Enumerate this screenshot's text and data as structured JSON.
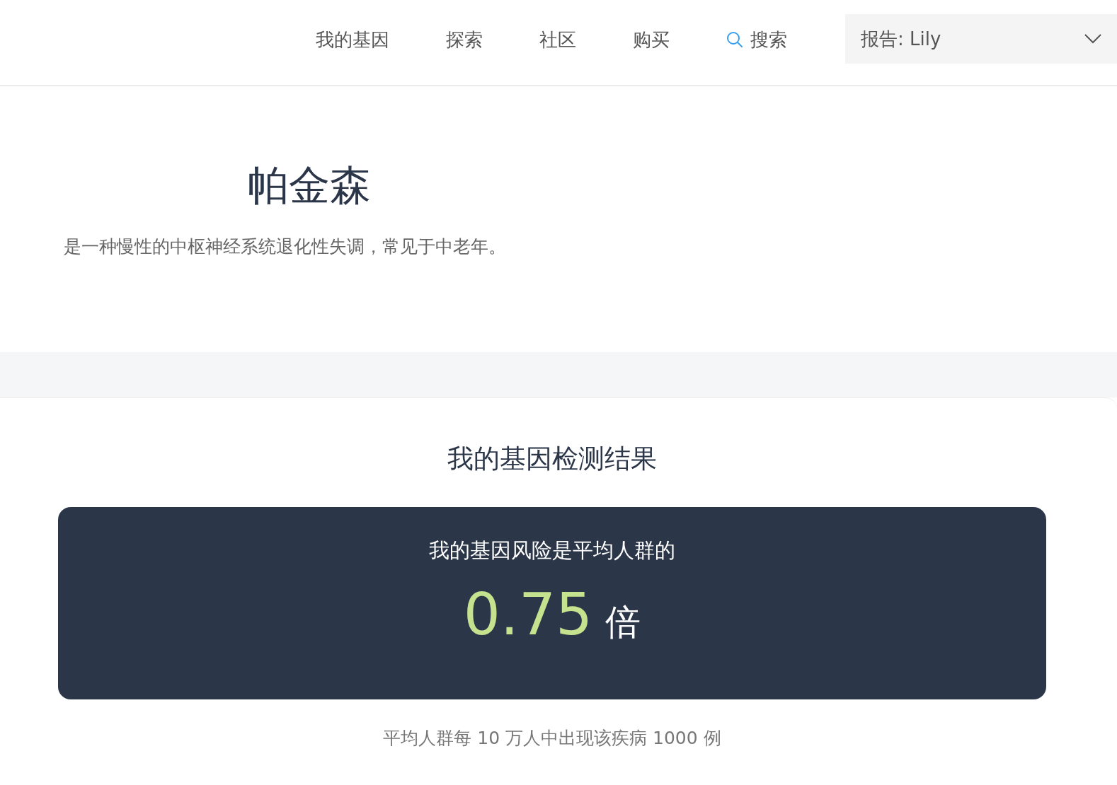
{
  "nav": {
    "items": [
      {
        "label": "我的基因",
        "kind": "link"
      },
      {
        "label": "探索",
        "kind": "link"
      },
      {
        "label": "社区",
        "kind": "link"
      },
      {
        "label": "购买",
        "kind": "link"
      },
      {
        "label": "搜索",
        "kind": "search"
      }
    ],
    "report_select": {
      "value": "报告: Lily"
    }
  },
  "disease": {
    "title": "帕金森",
    "description": "是一种慢性的中枢神经系统退化性失调，常见于中老年。"
  },
  "result": {
    "heading": "我的基因检测结果",
    "risk_label": "我的基因风险是平均人群的",
    "risk_value": "0.75",
    "risk_unit": "倍",
    "note": "平均人群每 10 万人中出现该疾病 1000 例"
  }
}
